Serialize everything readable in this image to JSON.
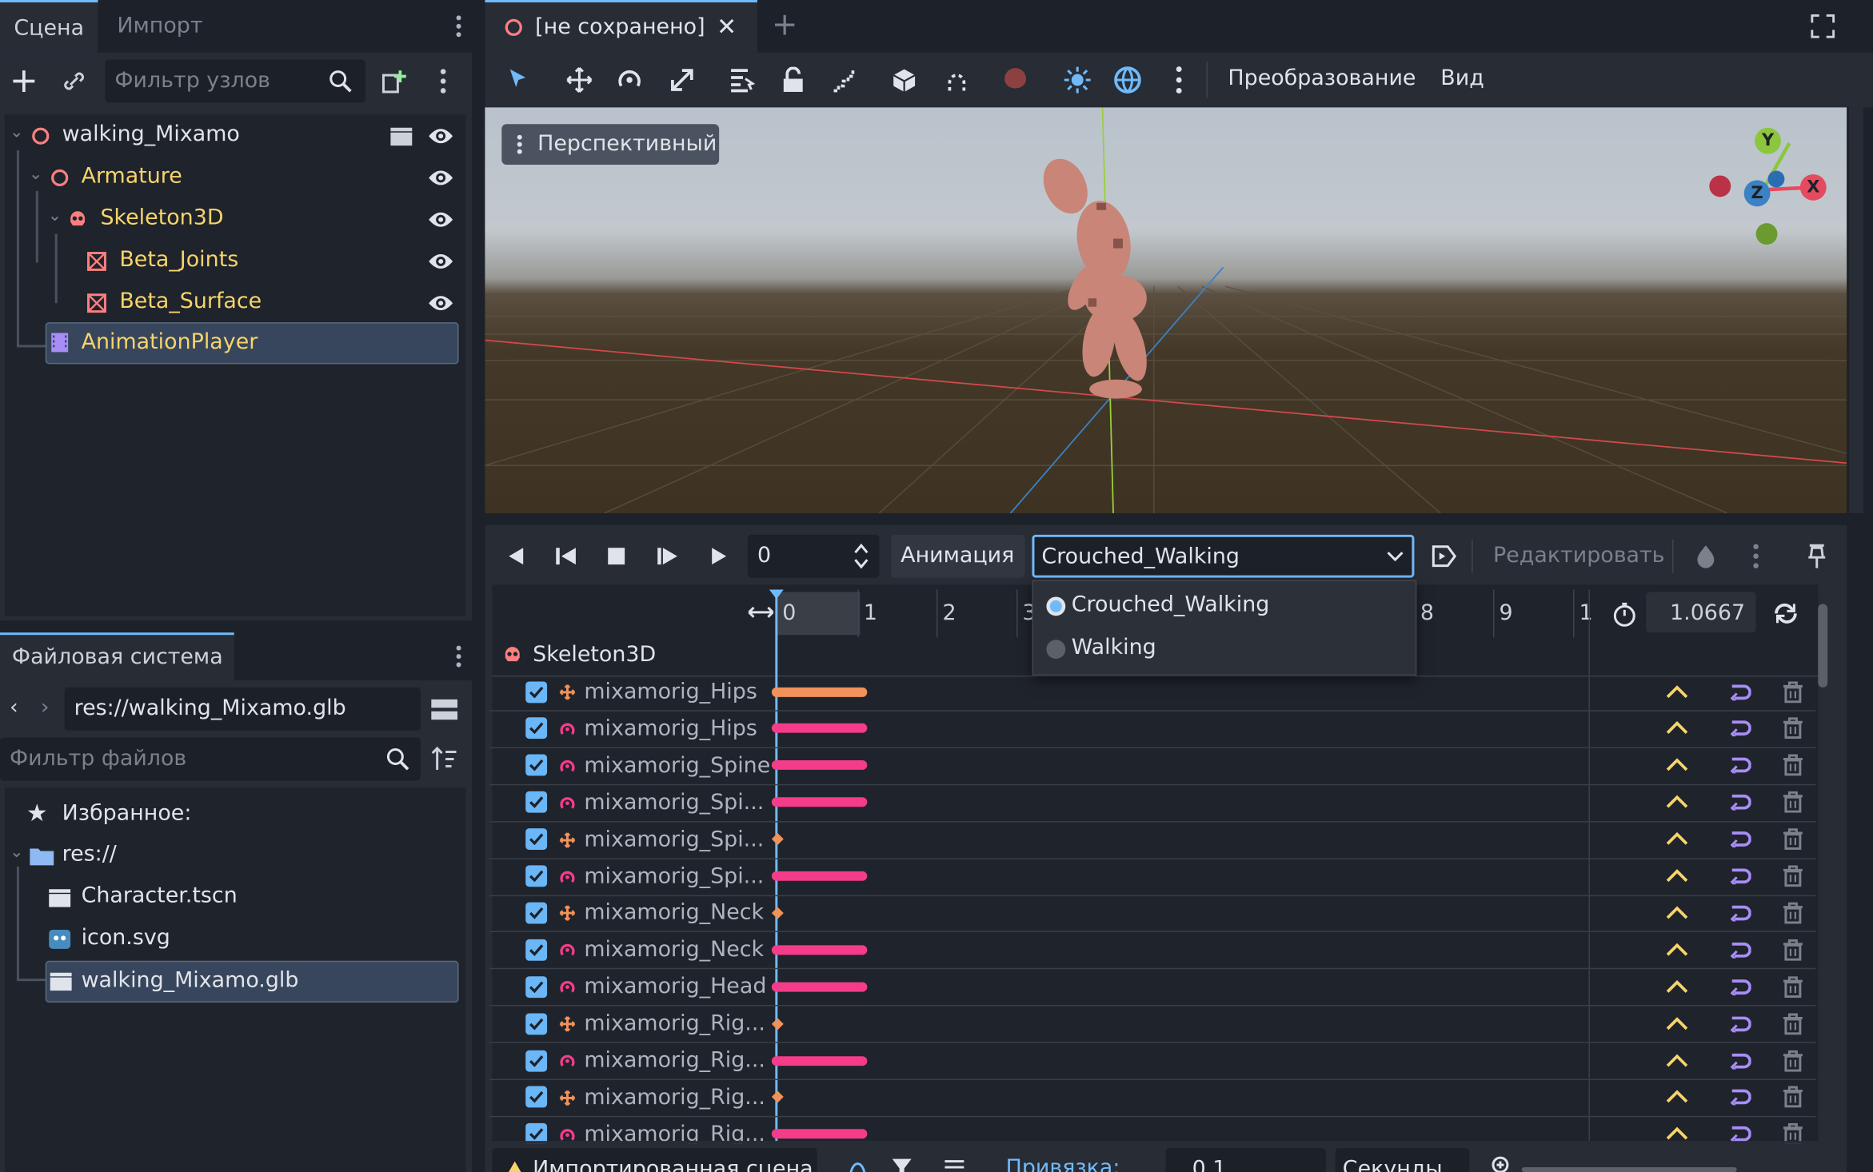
{
  "left_dock": {
    "tabs": [
      "Сцена",
      "Импорт"
    ],
    "filter_placeholder": "Фильтр узлов",
    "tree": [
      {
        "label": "walking_Mixamo",
        "depth": 0,
        "icon": "node3d-icon"
      },
      {
        "label": "Armature",
        "depth": 1,
        "icon": "node3d-icon"
      },
      {
        "label": "Skeleton3D",
        "depth": 2,
        "icon": "skeleton-icon"
      },
      {
        "label": "Beta_Joints",
        "depth": 3,
        "icon": "mesh-icon"
      },
      {
        "label": "Beta_Surface",
        "depth": 3,
        "icon": "mesh-icon"
      },
      {
        "label": "AnimationPlayer",
        "depth": 1,
        "icon": "animation-player-icon"
      }
    ]
  },
  "filesystem": {
    "tab": "Файловая система",
    "path": "res://walking_Mixamo.glb",
    "filter_placeholder": "Фильтр файлов",
    "items": [
      {
        "label": "Избранное:",
        "icon": "star-icon"
      },
      {
        "label": "res://",
        "icon": "folder-icon"
      },
      {
        "label": "Character.tscn",
        "icon": "scene-icon"
      },
      {
        "label": "icon.svg",
        "icon": "image-icon"
      },
      {
        "label": "walking_Mixamo.glb",
        "icon": "scene-icon"
      }
    ]
  },
  "editor": {
    "tab_title": "[не сохранено]",
    "menus": [
      "Преобразование",
      "Вид"
    ],
    "viewport_label": "Перспективный",
    "gizmo": {
      "y": "Y",
      "x": "X",
      "z": "Z"
    }
  },
  "animation": {
    "time_value": "0",
    "label": "Анимация",
    "selected": "Crouched_Walking",
    "options": [
      "Crouched_Walking",
      "Walking"
    ],
    "edit_label": "Редактировать",
    "length": "1.0667",
    "timeline_ticks": [
      "0",
      "1",
      "2",
      "3",
      "8",
      "9",
      "1"
    ],
    "root_track": "Skeleton3D",
    "tracks": [
      {
        "name": "mixamorig_Hips",
        "kind": "position"
      },
      {
        "name": "mixamorig_Hips",
        "kind": "rotation"
      },
      {
        "name": "mixamorig_Spine",
        "kind": "rotation"
      },
      {
        "name": "mixamorig_Spi...",
        "kind": "rotation"
      },
      {
        "name": "mixamorig_Spi...",
        "kind": "position"
      },
      {
        "name": "mixamorig_Spi...",
        "kind": "rotation"
      },
      {
        "name": "mixamorig_Neck",
        "kind": "position"
      },
      {
        "name": "mixamorig_Neck",
        "kind": "rotation"
      },
      {
        "name": "mixamorig_Head",
        "kind": "rotation"
      },
      {
        "name": "mixamorig_Rig...",
        "kind": "position"
      },
      {
        "name": "mixamorig_Rig...",
        "kind": "rotation"
      },
      {
        "name": "mixamorig_Rig...",
        "kind": "position"
      },
      {
        "name": "mixamorig_Rig...",
        "kind": "rotation"
      }
    ],
    "bottom": {
      "warning": "Импортированная сцена",
      "snap_label": "Привязка:",
      "snap_value": "0.1",
      "unit": "Секунды"
    }
  }
}
